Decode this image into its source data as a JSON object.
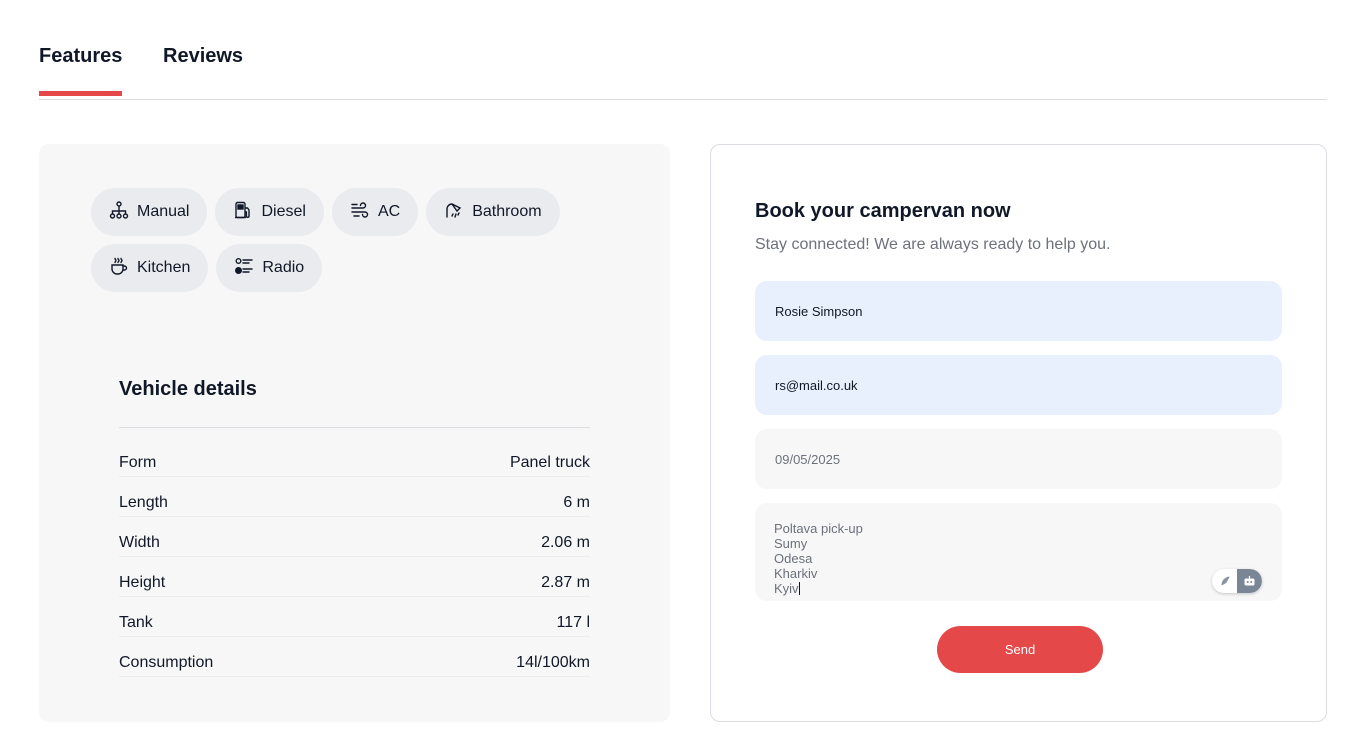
{
  "tabs": [
    {
      "label": "Features",
      "active": true
    },
    {
      "label": "Reviews",
      "active": false
    }
  ],
  "features": [
    {
      "label": "Manual",
      "icon": "transmission-icon"
    },
    {
      "label": "Diesel",
      "icon": "fuel-pump-icon"
    },
    {
      "label": "AC",
      "icon": "wind-icon"
    },
    {
      "label": "Bathroom",
      "icon": "shower-icon"
    },
    {
      "label": "Kitchen",
      "icon": "cup-icon"
    },
    {
      "label": "Radio",
      "icon": "radio-list-icon"
    }
  ],
  "vehicle_details": {
    "title": "Vehicle details",
    "rows": [
      {
        "label": "Form",
        "value": "Panel truck"
      },
      {
        "label": "Length",
        "value": "6 m"
      },
      {
        "label": "Width",
        "value": "2.06 m"
      },
      {
        "label": "Height",
        "value": "2.87 m"
      },
      {
        "label": "Tank",
        "value": "117 l"
      },
      {
        "label": "Consumption",
        "value": "14l/100km"
      }
    ]
  },
  "booking": {
    "title": "Book your campervan now",
    "subtitle": "Stay connected! We are always ready to help you.",
    "name_value": "Rosie Simpson",
    "email_value": "rs@mail.co.uk",
    "date_value": "09/05/2025",
    "comment_lines": [
      "Poltava pick-up",
      "Sumy",
      "Odesa",
      "Kharkiv",
      "Kyiv"
    ],
    "send_label": "Send"
  },
  "colors": {
    "accent": "#e44848",
    "text": "#101828",
    "muted": "#6c717b",
    "panel_bg": "#f7f7f7",
    "autofill_bg": "#e8f0fe"
  }
}
